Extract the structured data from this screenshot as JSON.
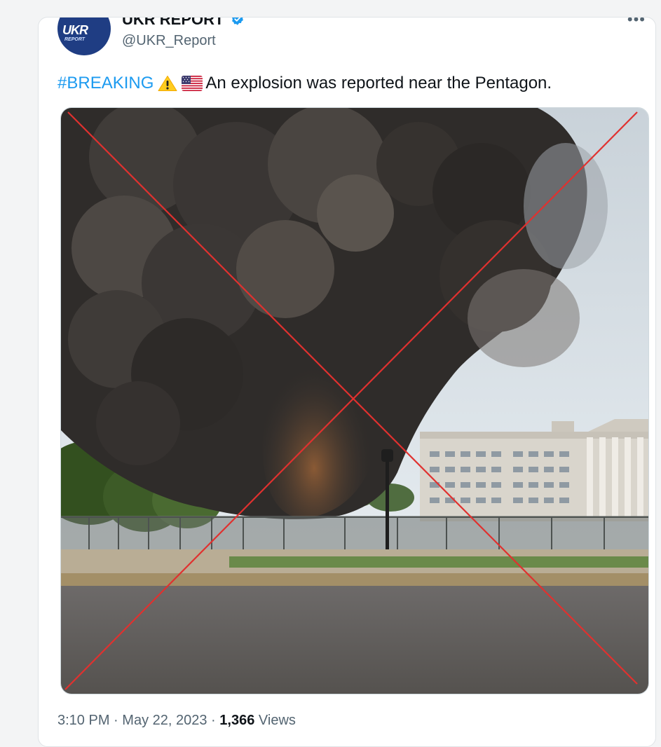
{
  "tweet": {
    "avatar_text": "UKR",
    "avatar_subtext": "REPORT",
    "display_name": "UKR REPORT",
    "handle": "@UKR_Report",
    "more_icon": "more-horizontal-icon",
    "hashtag": "#BREAKING",
    "text": "An explosion was reported near the Pentagon.",
    "icons": [
      "warning-icon",
      "us-flag-icon",
      "verified-badge-icon"
    ],
    "media": {
      "crossed_out": true,
      "cross_color": "#e0312f"
    },
    "time": "3:10 PM",
    "separator": "·",
    "date": "May 22, 2023",
    "views_count": "1,366",
    "views_label": "Views"
  },
  "colors": {
    "link": "#1d9bf0",
    "verified": "#1d9bf0",
    "text": "#0f1419",
    "secondary": "#536471"
  }
}
